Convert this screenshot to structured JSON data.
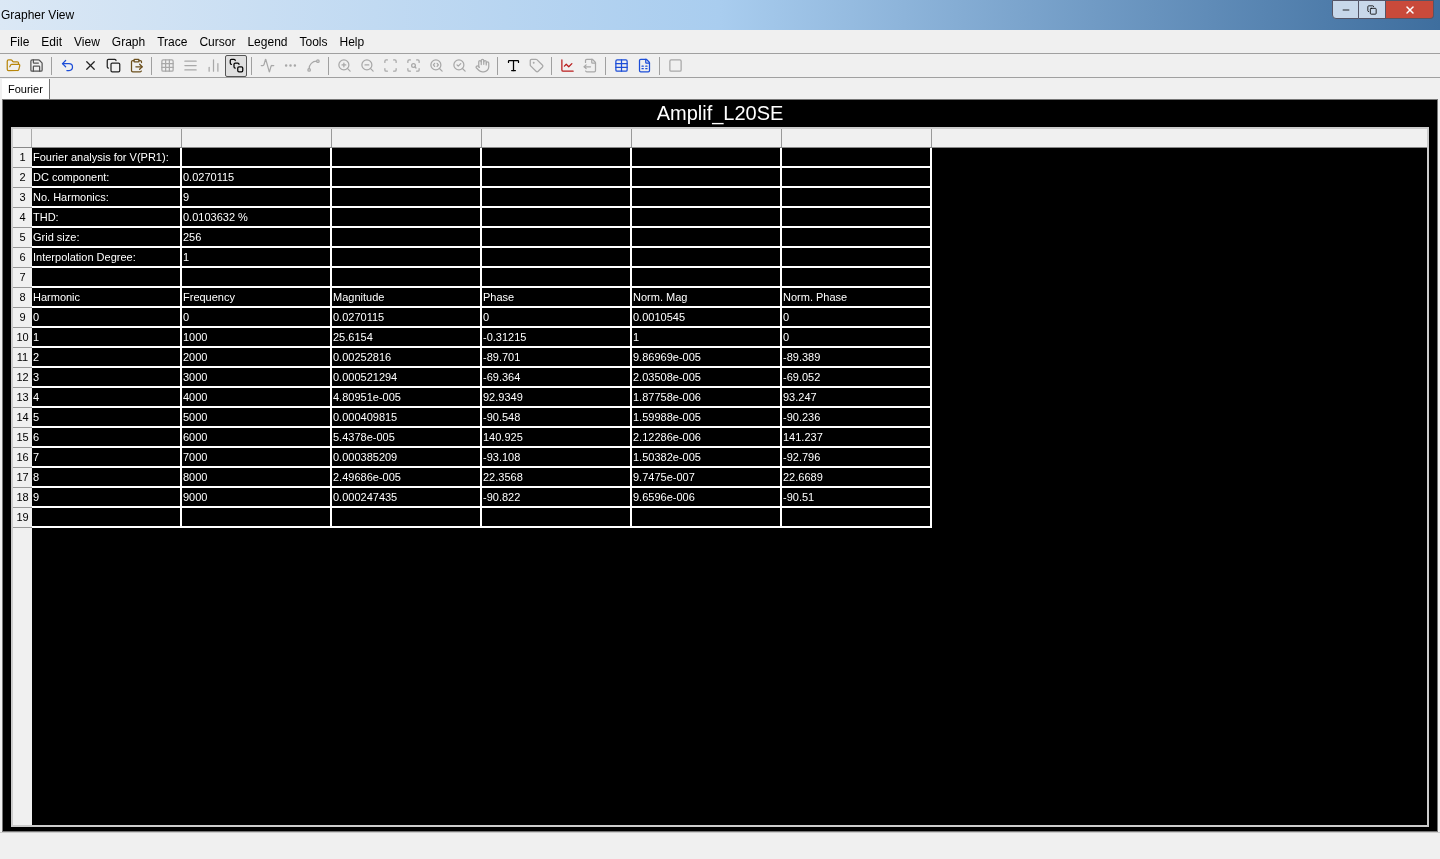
{
  "window": {
    "title": "Grapher View"
  },
  "menu": [
    "File",
    "Edit",
    "View",
    "Graph",
    "Trace",
    "Cursor",
    "Legend",
    "Tools",
    "Help"
  ],
  "toolbar": [
    {
      "kind": "open",
      "disabled": false,
      "selected": false
    },
    {
      "kind": "save",
      "disabled": false,
      "selected": false
    },
    {
      "kind": "sep"
    },
    {
      "kind": "undo",
      "disabled": false,
      "selected": false
    },
    {
      "kind": "cut",
      "disabled": false,
      "selected": false
    },
    {
      "kind": "copy",
      "disabled": false,
      "selected": false
    },
    {
      "kind": "paste",
      "disabled": false,
      "selected": false
    },
    {
      "kind": "sep"
    },
    {
      "kind": "grid",
      "disabled": true,
      "selected": false
    },
    {
      "kind": "list",
      "disabled": true,
      "selected": false
    },
    {
      "kind": "bars",
      "disabled": true,
      "selected": false
    },
    {
      "kind": "overlay",
      "disabled": false,
      "selected": true
    },
    {
      "kind": "sep"
    },
    {
      "kind": "line",
      "disabled": true,
      "selected": false
    },
    {
      "kind": "points",
      "disabled": true,
      "selected": false
    },
    {
      "kind": "linepoints",
      "disabled": true,
      "selected": false
    },
    {
      "kind": "sep"
    },
    {
      "kind": "zoomin",
      "disabled": true,
      "selected": false
    },
    {
      "kind": "zoomout",
      "disabled": true,
      "selected": false
    },
    {
      "kind": "zoomarea",
      "disabled": true,
      "selected": false
    },
    {
      "kind": "zoomx",
      "disabled": true,
      "selected": false
    },
    {
      "kind": "zoomy",
      "disabled": true,
      "selected": false
    },
    {
      "kind": "zoomfit",
      "disabled": true,
      "selected": false
    },
    {
      "kind": "pan",
      "disabled": true,
      "selected": false
    },
    {
      "kind": "sep"
    },
    {
      "kind": "text",
      "disabled": false,
      "selected": false
    },
    {
      "kind": "label",
      "disabled": true,
      "selected": false
    },
    {
      "kind": "sep"
    },
    {
      "kind": "traces",
      "disabled": false,
      "selected": false
    },
    {
      "kind": "export",
      "disabled": true,
      "selected": false
    },
    {
      "kind": "sep"
    },
    {
      "kind": "table",
      "disabled": false,
      "selected": false
    },
    {
      "kind": "excel",
      "disabled": false,
      "selected": false
    },
    {
      "kind": "sep"
    },
    {
      "kind": "stop",
      "disabled": true,
      "selected": false
    }
  ],
  "tabs": [
    {
      "label": "Fourier",
      "selected": true
    }
  ],
  "graph": {
    "title": "Amplif_L20SE"
  },
  "table": {
    "rows": [
      {
        "number": "1",
        "cells": [
          "Fourier analysis for V(PR1):"
        ]
      },
      {
        "number": "2",
        "cells": [
          "DC component:",
          "0.0270115"
        ]
      },
      {
        "number": "3",
        "cells": [
          "No. Harmonics:",
          "9"
        ]
      },
      {
        "number": "4",
        "cells": [
          "THD:",
          "0.0103632 %"
        ]
      },
      {
        "number": "5",
        "cells": [
          "Grid size:",
          "256"
        ]
      },
      {
        "number": "6",
        "cells": [
          "Interpolation Degree:",
          "1"
        ]
      },
      {
        "number": "7",
        "cells": []
      },
      {
        "number": "8",
        "cells": [
          "Harmonic",
          "Frequency",
          "Magnitude",
          "Phase",
          "Norm. Mag",
          "Norm. Phase"
        ]
      },
      {
        "number": "9",
        "cells": [
          "0",
          "0",
          "0.0270115",
          "0",
          "0.0010545",
          "0"
        ]
      },
      {
        "number": "10",
        "cells": [
          "1",
          "1000",
          "25.6154",
          "-0.31215",
          "1",
          "0"
        ]
      },
      {
        "number": "11",
        "cells": [
          "2",
          "2000",
          "0.00252816",
          "-89.701",
          "9.86969e-005",
          "-89.389"
        ]
      },
      {
        "number": "12",
        "cells": [
          "3",
          "3000",
          "0.000521294",
          "-69.364",
          "2.03508e-005",
          "-69.052"
        ]
      },
      {
        "number": "13",
        "cells": [
          "4",
          "4000",
          "4.80951e-005",
          "92.9349",
          "1.87758e-006",
          "93.247"
        ]
      },
      {
        "number": "14",
        "cells": [
          "5",
          "5000",
          "0.000409815",
          "-90.548",
          "1.59988e-005",
          "-90.236"
        ]
      },
      {
        "number": "15",
        "cells": [
          "6",
          "6000",
          "5.4378e-005",
          "140.925",
          "2.12286e-006",
          "141.237"
        ]
      },
      {
        "number": "16",
        "cells": [
          "7",
          "7000",
          "0.000385209",
          "-93.108",
          "1.50382e-005",
          "-92.796"
        ]
      },
      {
        "number": "17",
        "cells": [
          "8",
          "8000",
          "2.49686e-005",
          "22.3568",
          "9.7475e-007",
          "22.6689"
        ]
      },
      {
        "number": "18",
        "cells": [
          "9",
          "9000",
          "0.000247435",
          "-90.822",
          "9.6596e-006",
          "-90.51"
        ]
      },
      {
        "number": "19",
        "cells": []
      }
    ]
  }
}
